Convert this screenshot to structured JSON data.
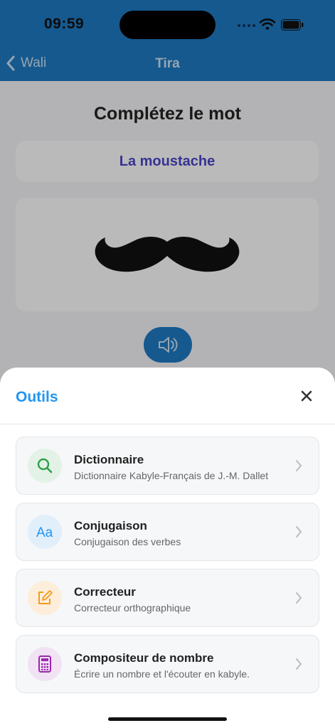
{
  "status_bar": {
    "time": "09:59"
  },
  "nav": {
    "back_label": "Wali",
    "title": "Tira"
  },
  "exercise": {
    "title": "Complétez le mot",
    "word": "La moustache",
    "image": "mustache-icon",
    "sound_icon": "speaker-icon"
  },
  "sheet": {
    "title": "Outils",
    "tools": [
      {
        "title": "Dictionnaire",
        "subtitle": "Dictionnaire Kabyle-Français de J.-M. Dallet",
        "icon": "search-icon",
        "color": "#2e9e4a"
      },
      {
        "title": "Conjugaison",
        "subtitle": "Conjugaison des verbes",
        "icon": "text-aa-icon",
        "color": "#2196F3"
      },
      {
        "title": "Correcteur",
        "subtitle": "Correcteur orthographique",
        "icon": "edit-icon",
        "color": "#f59a1b"
      },
      {
        "title": "Compositeur de nombre",
        "subtitle": "Écrire un nombre et l'écouter en kabyle.",
        "icon": "calculator-icon",
        "color": "#9c27b0"
      }
    ]
  },
  "colors": {
    "header": "#1E78C2",
    "accent": "#2196F3",
    "word": "#4b45c6"
  }
}
